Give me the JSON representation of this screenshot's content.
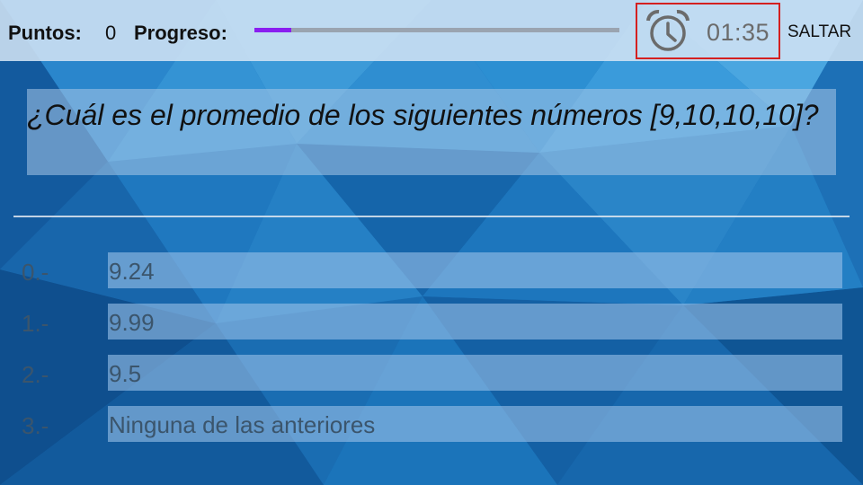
{
  "header": {
    "score_label": "Puntos:",
    "score_value": "0",
    "progress_label": "Progreso:",
    "progress_fraction": 0.1,
    "timer_icon": "alarm-clock-icon",
    "timer_value": "01:35",
    "skip_label": "SALTAR"
  },
  "question": {
    "text": "¿Cuál es el promedio de los siguientes números [9,10,10,10]?"
  },
  "options": [
    {
      "index": "0.-",
      "text": "9.24"
    },
    {
      "index": "1.-",
      "text": "9.99"
    },
    {
      "index": "2.-",
      "text": "9.5"
    },
    {
      "index": "3.-",
      "text": "Ninguna de las anteriores"
    }
  ],
  "colors": {
    "background": "#1a6fb8",
    "progress_fill": "#8a1ef0",
    "timer_border": "#d42020",
    "option_text": "#3b556c"
  }
}
